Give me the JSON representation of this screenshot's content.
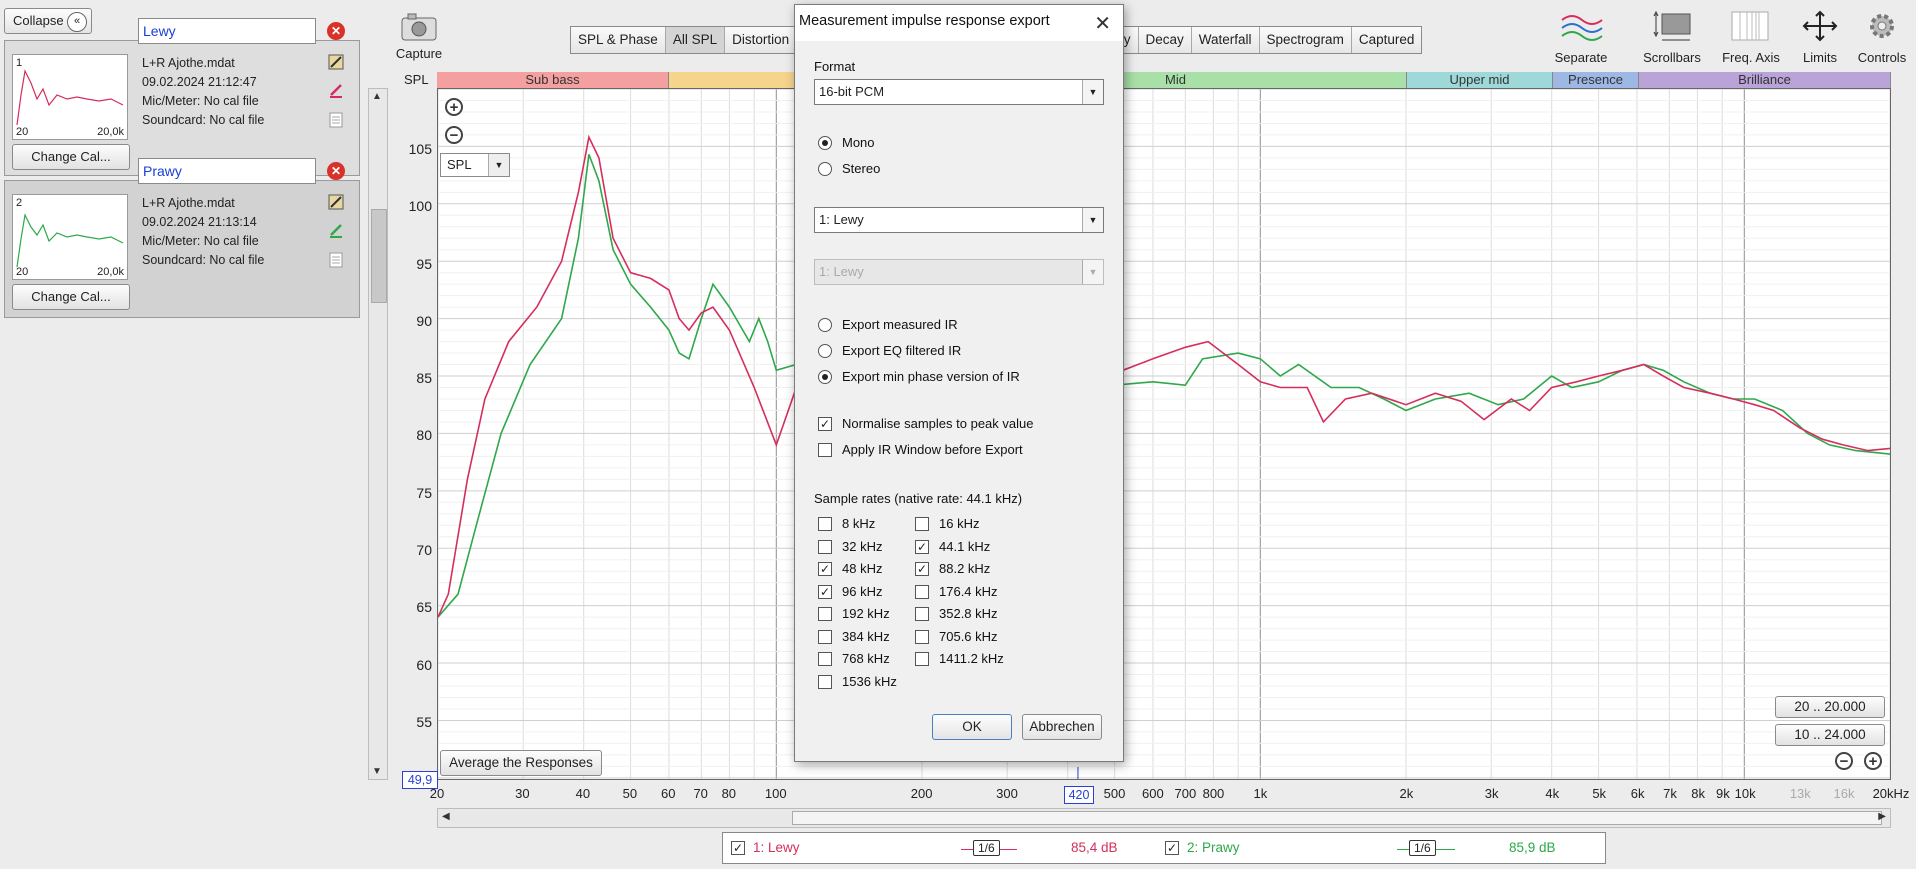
{
  "left_panel": {
    "collapse_label": "Collapse",
    "measurements": [
      {
        "num": "1",
        "name": "Lewy",
        "file": "L+R Ajothe.mdat",
        "date": "09.02.2024 21:12:47",
        "mic": "Mic/Meter: No cal file",
        "soundcard": "Soundcard: No cal file",
        "change_cal": "Change Cal...",
        "lo": "20",
        "hi": "20,0k",
        "color": "#d62e5c"
      },
      {
        "num": "2",
        "name": "Prawy",
        "file": "L+R Ajothe.mdat",
        "date": "09.02.2024 21:13:14",
        "mic": "Mic/Meter: No cal file",
        "soundcard": "Soundcard: No cal file",
        "change_cal": "Change Cal...",
        "lo": "20",
        "hi": "20,0k",
        "color": "#2ea84a"
      }
    ]
  },
  "toolbar": {
    "capture_label": "Capture",
    "tabs": [
      "SPL & Phase",
      "All SPL",
      "Distortion",
      "ity",
      "Decay",
      "Waterfall",
      "Spectrogram",
      "Captured"
    ],
    "active_tab": "All SPL",
    "right_tools": [
      "Separate",
      "Scrollbars",
      "Freq. Axis",
      "Limits",
      "Controls"
    ]
  },
  "chart": {
    "spl_label": "SPL",
    "bands": [
      {
        "label": "Sub bass",
        "color": "#f4a0a0"
      },
      {
        "label": "",
        "color": "#f5d58c"
      },
      {
        "label": "Mid",
        "color": "#a8e0a8"
      },
      {
        "label": "Upper mid",
        "color": "#9ed8d8"
      },
      {
        "label": "Presence",
        "color": "#9eb8e6"
      },
      {
        "label": "Brilliance",
        "color": "#b9a3d8"
      }
    ],
    "y_ticks": [
      "105",
      "100",
      "95",
      "90",
      "85",
      "80",
      "75",
      "70",
      "65",
      "60",
      "55"
    ],
    "y_readout": "49,9",
    "x_ticks": [
      "20",
      "30",
      "40",
      "50",
      "60",
      "70",
      "80",
      "100",
      "200",
      "300",
      "4",
      "500",
      "600",
      "700",
      "800",
      "1k",
      "2k",
      "3k",
      "4k",
      "5k",
      "6k",
      "7k",
      "8k",
      "9k",
      "10k",
      "13k",
      "16k",
      "20kHz"
    ],
    "x_readout": "420",
    "spl_select": "SPL",
    "avg_button": "Average the Responses",
    "range_buttons": [
      "20 .. 20.000",
      "10 .. 24.000"
    ]
  },
  "legend": {
    "items": [
      {
        "label": "1: Lewy",
        "smoothing": "1/6",
        "value": "85,4 dB",
        "color": "#d62e5c"
      },
      {
        "label": "2: Prawy",
        "smoothing": "1/6",
        "value": "85,9 dB",
        "color": "#2ea84a"
      }
    ]
  },
  "dialog": {
    "title": "Measurement impulse response export",
    "format_label": "Format",
    "format_value": "16-bit PCM",
    "channel_options": [
      "Mono",
      "Stereo"
    ],
    "channel_selected": "Mono",
    "measurement_select": "1: Lewy",
    "second_select": "1: Lewy",
    "export_options": [
      "Export measured IR",
      "Export EQ filtered IR",
      "Export min phase version of IR"
    ],
    "export_selected": "Export min phase version of IR",
    "normalise_label": "Normalise samples to peak value",
    "normalise_checked": "✓",
    "apply_window_label": "Apply IR Window before Export",
    "sample_rates_label": "Sample rates (native rate: 44.1 kHz)",
    "rates_left": [
      {
        "label": "8 kHz",
        "mark": ""
      },
      {
        "label": "32 kHz",
        "mark": ""
      },
      {
        "label": "48 kHz",
        "mark": "✓"
      },
      {
        "label": "96 kHz",
        "mark": "✓"
      },
      {
        "label": "192 kHz",
        "mark": ""
      },
      {
        "label": "384 kHz",
        "mark": ""
      },
      {
        "label": "768 kHz",
        "mark": ""
      },
      {
        "label": "1536 kHz",
        "mark": ""
      }
    ],
    "rates_right": [
      {
        "label": "16 kHz",
        "mark": ""
      },
      {
        "label": "44.1 kHz",
        "mark": "✓"
      },
      {
        "label": "88.2 kHz",
        "mark": "✓"
      },
      {
        "label": "176.4 kHz",
        "mark": ""
      },
      {
        "label": "352.8 kHz",
        "mark": ""
      },
      {
        "label": "705.6 kHz",
        "mark": ""
      },
      {
        "label": "1411.2 kHz",
        "mark": ""
      }
    ],
    "ok_label": "OK",
    "cancel_label": "Abbrechen"
  }
}
